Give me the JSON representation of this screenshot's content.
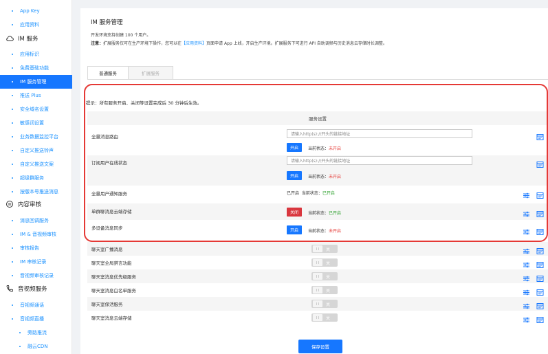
{
  "sidebar": {
    "items": [
      {
        "label": "App Key"
      },
      {
        "label": "应用资料"
      },
      {
        "label": "应用标识"
      },
      {
        "label": "免费基础功能"
      },
      {
        "label": "IM 服务管理"
      },
      {
        "label": "推送 Plus"
      },
      {
        "label": "安全域名设置"
      },
      {
        "label": "敏感词设置"
      },
      {
        "label": "业务数据监控平台"
      },
      {
        "label": "自定义推送铃声"
      },
      {
        "label": "自定义推送文案"
      },
      {
        "label": "超级群服务"
      },
      {
        "label": "按版本号推送消息"
      },
      {
        "label": "消息回调服务"
      },
      {
        "label": "IM & 音视频审核"
      },
      {
        "label": "审核报告"
      },
      {
        "label": "IM 审核记录"
      },
      {
        "label": "音视频审核记录"
      },
      {
        "label": "音视频通话"
      },
      {
        "label": "音视频直播"
      },
      {
        "label": "旁路推流"
      },
      {
        "label": "融云CDN"
      }
    ],
    "groups": [
      {
        "label": "IM 服务",
        "icon": "cloud-icon"
      },
      {
        "label": "内容审核",
        "icon": "eye-icon"
      },
      {
        "label": "音视频服务",
        "icon": "video-call-icon"
      }
    ]
  },
  "main": {
    "title": "IM 服务管理",
    "desc": "开发环境支持创建 100 个用户。",
    "note_bold": "注意：",
    "note_part1": "扩展服务仅可在生产环境下操作，您可以在",
    "note_link": "【应用资料】",
    "note_part2": "页面申请 App 上线，开启生产环境。扩展服务下可进行 API 自助调频与历史消息云存储时长调整。",
    "tabs": [
      {
        "label": "普通服务"
      },
      {
        "label": "扩展服务"
      }
    ],
    "tip": "提示：所有服务开启、关闭等设置完成后 30 分钟后生效。",
    "table_header": "服务设置",
    "url_placeholder": "请输入http(s)://开头的链接地址",
    "status_prefix": "当前状态：",
    "rows": [
      {
        "label": "全量消息路由",
        "button": "开启",
        "status": "未开启",
        "status_color": "#e53935"
      },
      {
        "label": "订阅用户在线状态",
        "button": "开启",
        "status": "未开启",
        "status_color": "#e53935"
      },
      {
        "label": "全量用户通知服务",
        "enabled_text": "已开启",
        "status": "已开启",
        "status_color": "#2ca02c"
      },
      {
        "label": "单群聊消息云端存储",
        "button": "关闭",
        "status": "已开启",
        "status_color": "#2ca02c"
      },
      {
        "label": "多设备消息同步",
        "button": "开启",
        "status": "未开启",
        "status_color": "#e53935"
      }
    ],
    "toggle_rows": [
      {
        "label": "聊天室广播消息",
        "state": "关"
      },
      {
        "label": "聊天室全局禁言功能",
        "state": "关"
      },
      {
        "label": "聊天室消息优先级服务",
        "state": "关"
      },
      {
        "label": "聊天室消息白名单服务",
        "state": "关"
      },
      {
        "label": "聊天室保活服务",
        "state": "关"
      },
      {
        "label": "聊天室消息云端存储",
        "state": "关"
      }
    ],
    "save_label": "保存设置"
  },
  "colors": {
    "accent": "#1677ff",
    "danger": "#d9363e",
    "highlight": "#e53935",
    "ok": "#2ca02c"
  }
}
